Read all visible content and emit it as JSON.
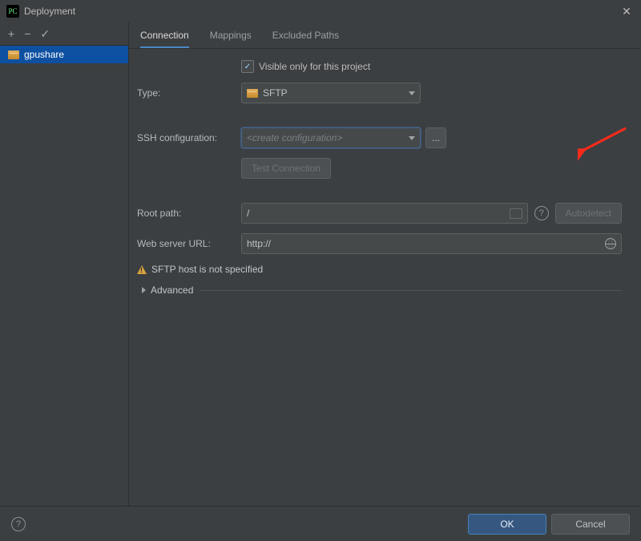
{
  "window": {
    "title": "Deployment"
  },
  "sidebar": {
    "items": [
      {
        "label": "gpushare"
      }
    ]
  },
  "tabs": [
    {
      "label": "Connection",
      "active": true
    },
    {
      "label": "Mappings",
      "active": false
    },
    {
      "label": "Excluded Paths",
      "active": false
    }
  ],
  "form": {
    "visible_only_label": "Visible only for this project",
    "visible_only_checked": true,
    "type_label": "Type:",
    "type_value": "SFTP",
    "ssh_label": "SSH configuration:",
    "ssh_placeholder": "<create configuration>",
    "ssh_browse": "...",
    "test_connection": "Test Connection",
    "root_path_label": "Root path:",
    "root_path_value": "/",
    "autodetect": "Autodetect",
    "web_url_label": "Web server URL:",
    "web_url_value": "http://",
    "warning_text": "SFTP host is not specified",
    "advanced_label": "Advanced"
  },
  "footer": {
    "ok": "OK",
    "cancel": "Cancel"
  }
}
